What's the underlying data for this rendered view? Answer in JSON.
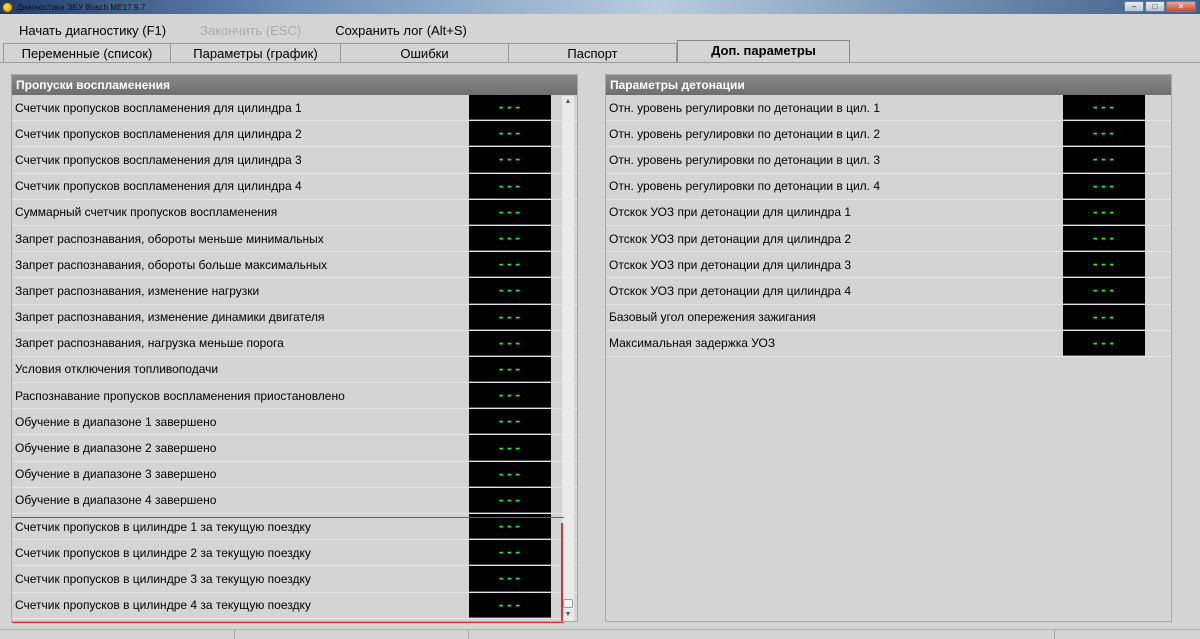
{
  "window": {
    "title": "Диагностика ЭБУ Bosch ME17.9.7",
    "minimize": "–",
    "maximize": "□",
    "close": "✕"
  },
  "menu": {
    "start": "Начать диагностику (F1)",
    "finish": "Закончить (ESC)",
    "save_log": "Сохранить лог (Alt+S)"
  },
  "tabs": [
    {
      "label": "Переменные (список)"
    },
    {
      "label": "Параметры (график)"
    },
    {
      "label": "Ошибки"
    },
    {
      "label": "Паспорт"
    },
    {
      "label": "Доп. параметры"
    }
  ],
  "left_panel": {
    "title": "Пропуски воспламенения",
    "rows": [
      {
        "label": "Счетчик пропусков воспламенения для цилиндра 1",
        "value": "---"
      },
      {
        "label": "Счетчик пропусков воспламенения для цилиндра 2",
        "value": "---"
      },
      {
        "label": "Счетчик пропусков воспламенения для цилиндра 3",
        "value": "---"
      },
      {
        "label": "Счетчик пропусков воспламенения для цилиндра 4",
        "value": "---"
      },
      {
        "label": "Суммарный счетчик пропусков воспламенения",
        "value": "---"
      },
      {
        "label": "Запрет распознавания, обороты меньше минимальных",
        "value": "---"
      },
      {
        "label": "Запрет распознавания, обороты больше максимальных",
        "value": "---"
      },
      {
        "label": "Запрет распознавания, изменение нагрузки",
        "value": "---"
      },
      {
        "label": "Запрет распознавания, изменение динамики двигателя",
        "value": "---"
      },
      {
        "label": "Запрет распознавания, нагрузка меньше порога",
        "value": "---"
      },
      {
        "label": "Условия отключения топливоподачи",
        "value": "---"
      },
      {
        "label": "Распознавание пропусков воспламенения приостановлено",
        "value": "---"
      },
      {
        "label": "Обучение в диапазоне 1 завершено",
        "value": "---"
      },
      {
        "label": "Обучение в диапазоне 2 завершено",
        "value": "---"
      },
      {
        "label": "Обучение в диапазоне 3 завершено",
        "value": "---"
      },
      {
        "label": "Обучение в диапазоне 4 завершено",
        "value": "---"
      },
      {
        "label": "Счетчик пропусков в цилиндре 1 за текущую поездку",
        "value": "---"
      },
      {
        "label": "Счетчик пропусков в цилиндре 2 за текущую поездку",
        "value": "---"
      },
      {
        "label": "Счетчик пропусков в цилиндре 3 за текущую поездку",
        "value": "---"
      },
      {
        "label": "Счетчик пропусков в цилиндре 4 за текущую поездку",
        "value": "---"
      }
    ]
  },
  "right_panel": {
    "title": "Параметры детонации",
    "rows": [
      {
        "label": "Отн. уровень регулировки по детонации в цил. 1",
        "value": "---"
      },
      {
        "label": "Отн. уровень регулировки по детонации в цил. 2",
        "value": "---"
      },
      {
        "label": "Отн. уровень регулировки по детонации в цил. 3",
        "value": "---"
      },
      {
        "label": "Отн. уровень регулировки по детонации в цил. 4",
        "value": "---"
      },
      {
        "label": "Отскок УОЗ при детонации для цилиндра 1",
        "value": "---"
      },
      {
        "label": "Отскок УОЗ при детонации для цилиндра 2",
        "value": "---"
      },
      {
        "label": "Отскок УОЗ при детонации для цилиндра 3",
        "value": "---"
      },
      {
        "label": "Отскок УОЗ при детонации для цилиндра 4",
        "value": "---"
      },
      {
        "label": "Базовый угол опережения зажигания",
        "value": "---"
      },
      {
        "label": "Максимальная задержка УОЗ",
        "value": "---"
      }
    ]
  },
  "colors": {
    "value_text": "#2ee82e",
    "value_bg": "#000000",
    "header_bg": "#7a7a7a",
    "annotation": "#e23030"
  }
}
